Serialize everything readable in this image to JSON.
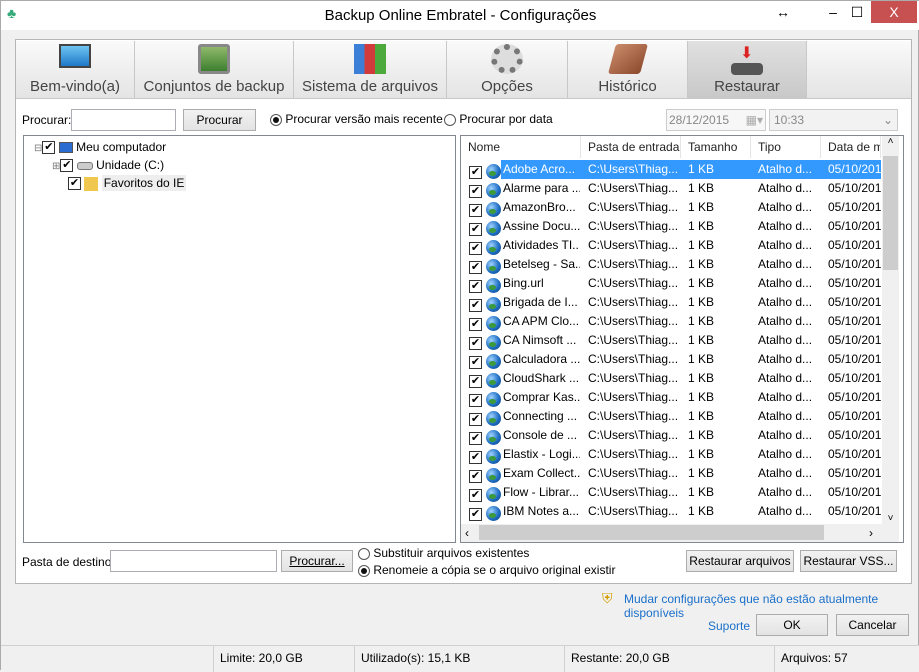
{
  "window": {
    "title": "Backup Online Embratel - Configurações",
    "close": "X"
  },
  "tabs": [
    {
      "label": "Bem-vindo(a)",
      "icon": "monitor-icon"
    },
    {
      "label": "Conjuntos de backup",
      "icon": "backup-set-icon"
    },
    {
      "label": "Sistema de arquivos",
      "icon": "folders-icon"
    },
    {
      "label": "Opções",
      "icon": "gears-icon"
    },
    {
      "label": "Histórico",
      "icon": "book-icon"
    },
    {
      "label": "Restaurar",
      "icon": "restore-icon",
      "active": true
    }
  ],
  "search": {
    "label": "Procurar:",
    "value": "",
    "button": "Procurar",
    "radio_recent": "Procurar versão mais recente",
    "radio_date": "Procurar por data",
    "selected": "recent",
    "date": "28/12/2015",
    "time": "10:33"
  },
  "tree": [
    {
      "label": "Meu computador",
      "checked": true
    },
    {
      "label": "Unidade (C:)",
      "checked": true
    },
    {
      "label": "Favoritos do IE",
      "checked": true
    }
  ],
  "list": {
    "columns": [
      "Nome",
      "Pasta de entrada",
      "Tamanho",
      "Tipo",
      "Data de m"
    ],
    "rows": [
      [
        "Adobe Acro...",
        "C:\\Users\\Thiag...",
        "1 KB",
        "Atalho d...",
        "05/10/201"
      ],
      [
        "Alarme para ...",
        "C:\\Users\\Thiag...",
        "1 KB",
        "Atalho d...",
        "05/10/201"
      ],
      [
        "AmazonBro...",
        "C:\\Users\\Thiag...",
        "1 KB",
        "Atalho d...",
        "05/10/201"
      ],
      [
        "Assine Docu...",
        "C:\\Users\\Thiag...",
        "1 KB",
        "Atalho d...",
        "05/10/201"
      ],
      [
        "Atividades TI...",
        "C:\\Users\\Thiag...",
        "1 KB",
        "Atalho d...",
        "05/10/201"
      ],
      [
        "Betelseg - Sa...",
        "C:\\Users\\Thiag...",
        "1 KB",
        "Atalho d...",
        "05/10/201"
      ],
      [
        "Bing.url",
        "C:\\Users\\Thiag...",
        "1 KB",
        "Atalho d...",
        "05/10/201"
      ],
      [
        "Brigada de I...",
        "C:\\Users\\Thiag...",
        "1 KB",
        "Atalho d...",
        "05/10/201"
      ],
      [
        "CA APM Clo...",
        "C:\\Users\\Thiag...",
        "1 KB",
        "Atalho d...",
        "05/10/201"
      ],
      [
        "CA Nimsoft ...",
        "C:\\Users\\Thiag...",
        "1 KB",
        "Atalho d...",
        "05/10/201"
      ],
      [
        "Calculadora ...",
        "C:\\Users\\Thiag...",
        "1 KB",
        "Atalho d...",
        "05/10/201"
      ],
      [
        "CloudShark ...",
        "C:\\Users\\Thiag...",
        "1 KB",
        "Atalho d...",
        "05/10/201"
      ],
      [
        "Comprar Kas...",
        "C:\\Users\\Thiag...",
        "1 KB",
        "Atalho d...",
        "05/10/201"
      ],
      [
        "Connecting ...",
        "C:\\Users\\Thiag...",
        "1 KB",
        "Atalho d...",
        "05/10/201"
      ],
      [
        "Console de ...",
        "C:\\Users\\Thiag...",
        "1 KB",
        "Atalho d...",
        "05/10/201"
      ],
      [
        "Elastix - Logi...",
        "C:\\Users\\Thiag...",
        "1 KB",
        "Atalho d...",
        "05/10/201"
      ],
      [
        "Exam Collect...",
        "C:\\Users\\Thiag...",
        "1 KB",
        "Atalho d...",
        "05/10/201"
      ],
      [
        "Flow - Librar...",
        "C:\\Users\\Thiag...",
        "1 KB",
        "Atalho d...",
        "05/10/201"
      ],
      [
        "IBM Notes a...",
        "C:\\Users\\Thiag...",
        "1 KB",
        "Atalho d...",
        "05/10/201"
      ]
    ]
  },
  "destination": {
    "label": "Pasta de destino:",
    "value": "",
    "browse": "Procurar...",
    "opt_replace": "Substituir arquivos existentes",
    "opt_rename": "Renomeie a cópia se o arquivo original existir",
    "selected": "rename",
    "restore_files": "Restaurar arquivos",
    "restore_vss": "Restaurar VSS..."
  },
  "admin_link": "Mudar configurações que não estão atualmente disponíveis",
  "support": "Suporte",
  "ok": "OK",
  "cancel": "Cancelar",
  "status": {
    "limit": "Limite: 20,0 GB",
    "used": "Utilizado(s): 15,1 KB",
    "remaining": "Restante: 20,0 GB",
    "files": "Arquivos: 57"
  },
  "colors": {
    "selection": "#3399ff",
    "link": "#1a6fc9",
    "close": "#c75050"
  }
}
